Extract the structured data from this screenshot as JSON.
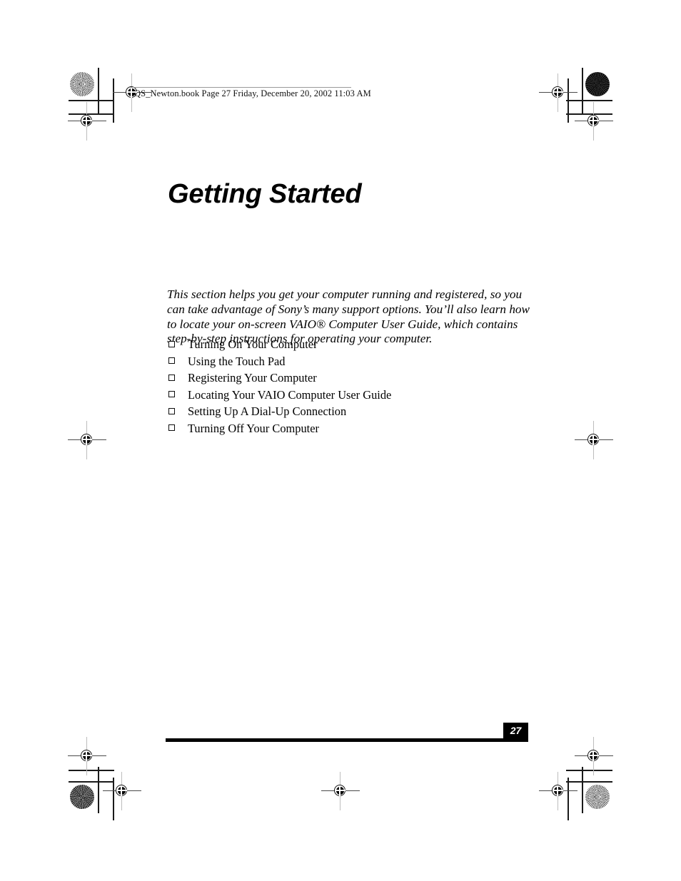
{
  "document": {
    "file_header": "QS_Newton.book  Page 27  Friday, December 20, 2002  11:03 AM",
    "chapter_title": "Getting Started",
    "intro_paragraph": "This section helps you get your computer running and registered, so you can take advantage of Sony’s many support options. You’ll also learn how to locate your on-screen VAIO® Computer User Guide, which contains step-by-step instructions for operating your computer.",
    "page_number": "27"
  },
  "topics": [
    {
      "label": "Turning On Your Computer"
    },
    {
      "label": "Using the Touch Pad"
    },
    {
      "label": "Registering Your Computer"
    },
    {
      "label": "Locating Your VAIO Computer User Guide"
    },
    {
      "label": "Setting Up A Dial-Up Connection"
    },
    {
      "label": "Turning Off Your Computer"
    }
  ],
  "colors": {
    "text": "#000000",
    "page_background": "#ffffff",
    "footer_rule": "#000000",
    "page_number_text": "#ffffff",
    "crop_mark": "#1a1a1a"
  }
}
